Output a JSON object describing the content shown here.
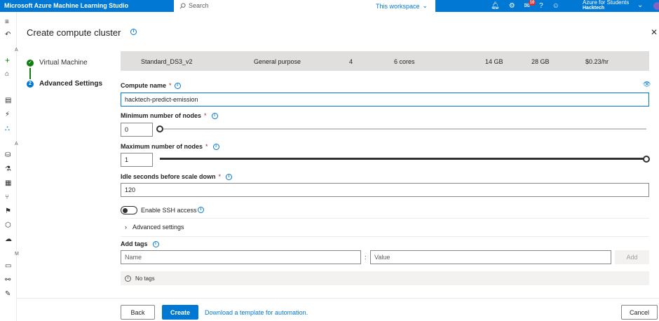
{
  "app": {
    "title": "Microsoft Azure Machine Learning Studio",
    "search_placeholder": "Search",
    "search_scope": "This workspace",
    "notification_count": "10",
    "account_line1": "Azure for Students",
    "account_line2": "Hacktech"
  },
  "rail": {
    "letters": [
      "A",
      "A",
      "M"
    ]
  },
  "panel": {
    "title": "Create compute cluster"
  },
  "steps": [
    {
      "label": "Virtual Machine",
      "status": "done"
    },
    {
      "label": "Advanced Settings",
      "status": "current",
      "number": "2"
    }
  ],
  "vm": {
    "name": "Standard_DS3_v2",
    "category": "General purpose",
    "workload": "4",
    "cores": "6 cores",
    "ram": "14 GB",
    "storage": "28 GB",
    "cost": "$0.23/hr"
  },
  "form": {
    "compute_name_label": "Compute name",
    "compute_name_value": "hacktech-predict-emission",
    "min_nodes_label": "Minimum number of nodes",
    "min_nodes_value": "0",
    "max_nodes_label": "Maximum number of nodes",
    "max_nodes_value": "1",
    "idle_label": "Idle seconds before scale down",
    "idle_value": "120",
    "ssh_label": "Enable SSH access",
    "ssh_enabled": false,
    "advanced_label": "Advanced settings",
    "tags_label": "Add tags",
    "tag_name_placeholder": "Name",
    "tag_value_placeholder": "Value",
    "tag_separator": ":",
    "add_label": "Add",
    "no_tags": "No tags",
    "required_mark": "*"
  },
  "slider": {
    "min_fraction": 0.0,
    "max_fraction": 1.0
  },
  "footer": {
    "back": "Back",
    "create": "Create",
    "template_link": "Download a template for automation.",
    "cancel": "Cancel"
  },
  "colors": {
    "accent": "#0078d4",
    "success": "#107c10",
    "required": "#a4262c"
  }
}
